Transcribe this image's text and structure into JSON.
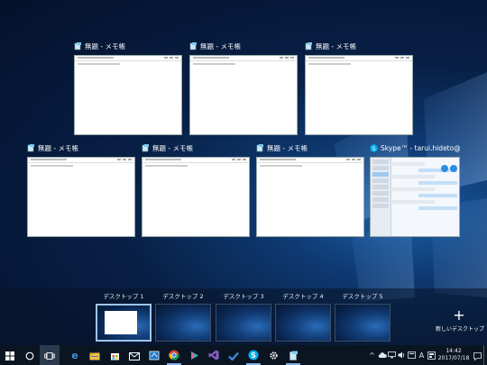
{
  "windows": [
    {
      "title": "無題 - メモ帳",
      "app": "notepad"
    },
    {
      "title": "無題 - メモ帳",
      "app": "notepad"
    },
    {
      "title": "無題 - メモ帳",
      "app": "notepad"
    },
    {
      "title": "無題 - メモ帳",
      "app": "notepad"
    },
    {
      "title": "無題 - メモ帳",
      "app": "notepad"
    },
    {
      "title": "無題 - メモ帳",
      "app": "notepad"
    },
    {
      "title": "Skype™ - tarui.hideto@...",
      "app": "skype"
    }
  ],
  "desktops": [
    {
      "label": "デスクトップ 1",
      "active": true
    },
    {
      "label": "デスクトップ 2",
      "active": false
    },
    {
      "label": "デスクトップ 3",
      "active": false
    },
    {
      "label": "デスクトップ 4",
      "active": false
    },
    {
      "label": "デスクトップ 5",
      "active": false
    }
  ],
  "new_desktop": {
    "plus": "+",
    "label": "新しいデスクトップ"
  },
  "taskbar": {
    "apps": [
      "edge-icon",
      "file-explorer-icon",
      "store-icon",
      "mail-icon",
      "cortana-notebook-icon",
      "chrome-icon",
      "media-player-icon",
      "visual-studio-icon",
      "todo-check-icon",
      "skype-icon",
      "settings-icon",
      "notepad-icon"
    ]
  },
  "tray": {
    "chevron": "^",
    "ime": "A",
    "time": "14:42",
    "date": "2017/07/18"
  },
  "colors": {
    "accent": "#7fb2e5",
    "skype": "#00aff0",
    "taskbar": "#0b1522"
  }
}
